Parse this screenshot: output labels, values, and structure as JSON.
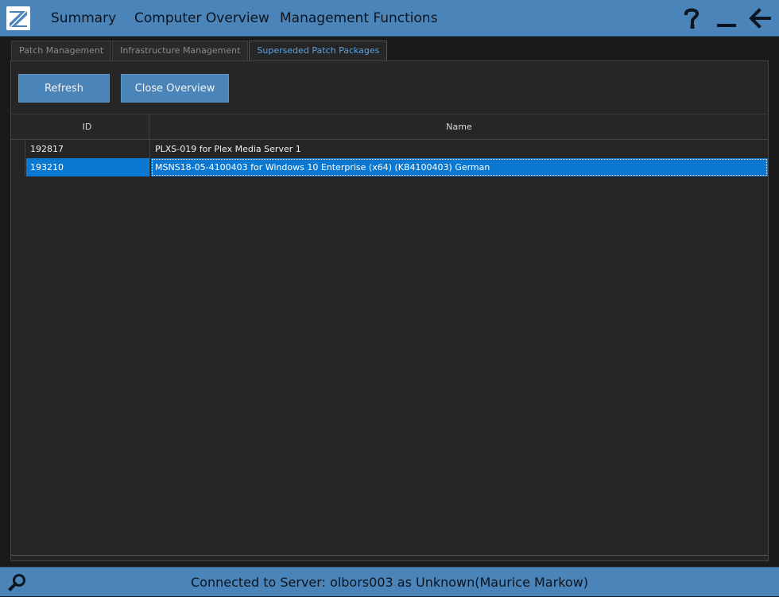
{
  "nav": {
    "items": [
      {
        "label": "Summary"
      },
      {
        "label": "Computer Overview"
      },
      {
        "label": "Management Functions"
      }
    ]
  },
  "icons": {
    "logo": "app-logo",
    "help": "question-mark-icon",
    "minimize": "minimize-icon",
    "back": "arrow-left-icon",
    "search": "magnifier-icon"
  },
  "tabs": [
    {
      "label": "Patch Management",
      "active": false
    },
    {
      "label": "Infrastructure Management",
      "active": false
    },
    {
      "label": "Superseded Patch Packages",
      "active": true
    }
  ],
  "toolbar": {
    "refresh_label": "Refresh",
    "close_label": "Close Overview"
  },
  "table": {
    "columns": [
      "ID",
      "Name"
    ],
    "rows": [
      {
        "id": "192817",
        "name": "PLXS-019 for Plex Media Server 1",
        "selected": false
      },
      {
        "id": "193210",
        "name": "MSNS18-05-4100403 for Windows 10 Enterprise (x64) (KB4100403) German",
        "selected": true
      }
    ]
  },
  "status": {
    "text": "Connected to Server: olbors003 as Unknown(Maurice Markow)"
  },
  "colors": {
    "accent": "#4a84b8",
    "selection": "#0a78d0",
    "active_tab_text": "#5aa2e0",
    "background": "#262626"
  }
}
